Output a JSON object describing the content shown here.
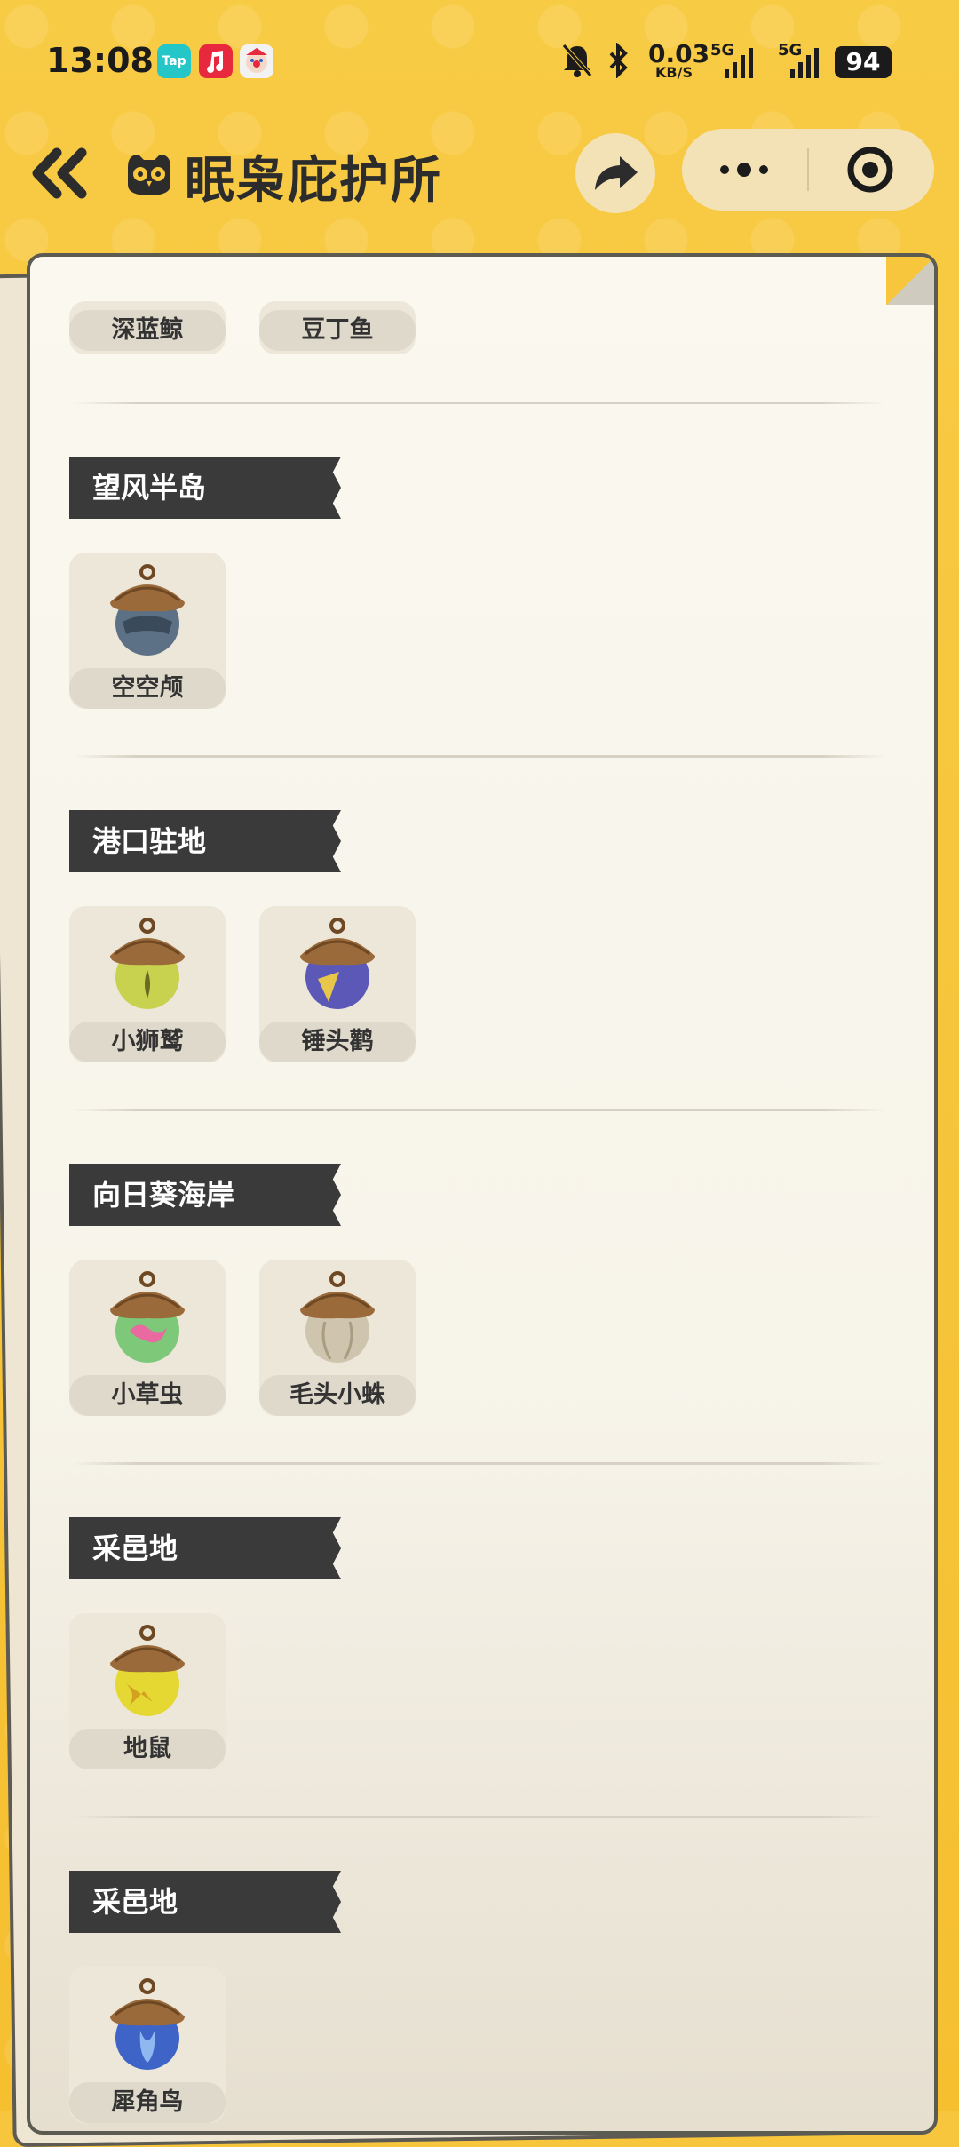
{
  "status_bar": {
    "time": "13:08",
    "apps": [
      "Tap"
    ],
    "net_speed": "0.03",
    "net_unit": "KB/S",
    "sig1": "5G",
    "sig2": "5G",
    "battery": "94"
  },
  "header": {
    "title": "眠枭庇护所"
  },
  "top_items": [
    "深蓝鲸",
    "豆丁鱼"
  ],
  "sections": [
    {
      "title": "望风半岛",
      "items": [
        {
          "name": "空空颅",
          "color": "#5D7186"
        }
      ]
    },
    {
      "title": "港口驻地",
      "items": [
        {
          "name": "小狮鹫",
          "color": "#C9D24F"
        },
        {
          "name": "锤头鹳",
          "color": "#5C58B8"
        }
      ]
    },
    {
      "title": "向日葵海岸",
      "items": [
        {
          "name": "小草虫",
          "color": "#7EC87A"
        },
        {
          "name": "毛头小蛛",
          "color": "#CFC5AE"
        }
      ]
    },
    {
      "title": "采邑地",
      "items": [
        {
          "name": "地鼠",
          "color": "#E6D832"
        }
      ]
    },
    {
      "title": "采邑地",
      "items": [
        {
          "name": "犀角鸟",
          "color": "#3E64C8"
        }
      ]
    }
  ],
  "colors": {
    "background": "#F7C63C",
    "paper": "#FAF8EF",
    "section_bar": "#3A3A3A"
  },
  "icons": [
    "back-double-chevron-icon",
    "owl-icon",
    "share-arrow-icon",
    "more-dots-icon",
    "target-close-icon"
  ]
}
